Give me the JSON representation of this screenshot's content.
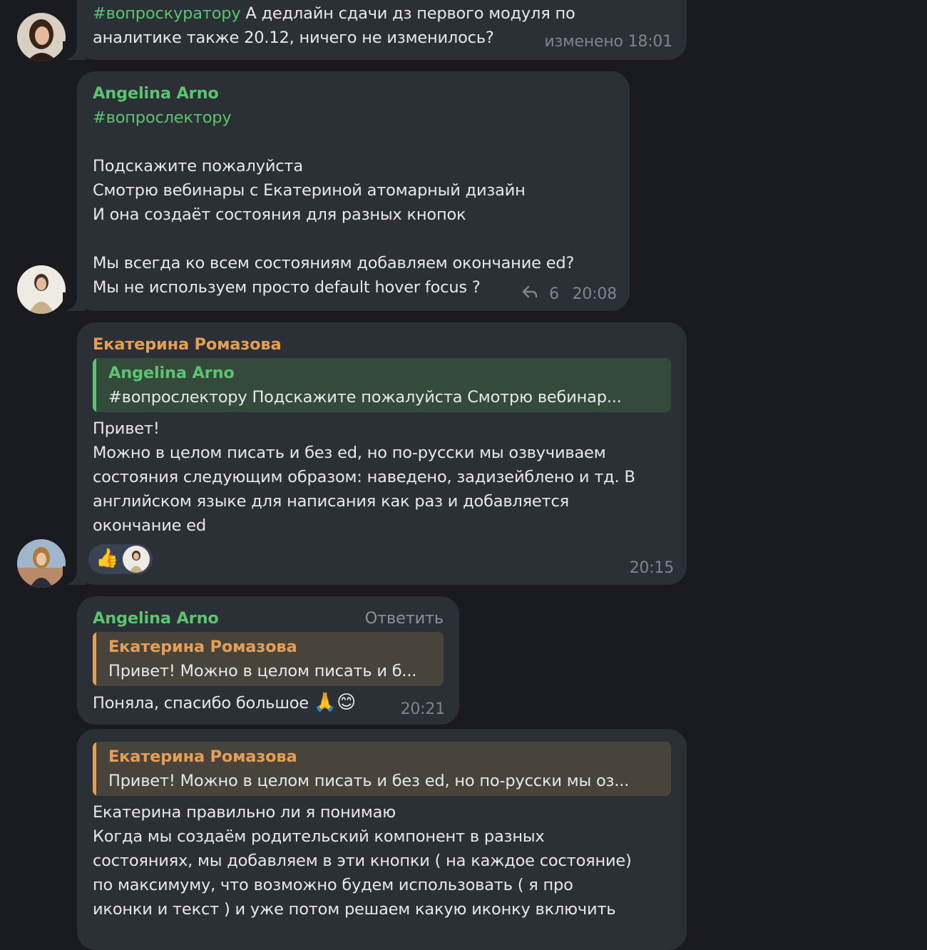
{
  "messages": [
    {
      "hashtag": "#вопроскуратору",
      "line1_rest": " А дедлайн сдачи дз первого модуля по",
      "line2": "аналитике также 20.12, ничего не изменилось?",
      "edited_label": "изменено",
      "time": "18:01"
    },
    {
      "sender": "Angelina Arno",
      "hashtag": "#вопрослектору",
      "lines_a": [
        "Подскажите пожалуйста",
        "Смотрю вебинары с Екатериной атомарный дизайн",
        "И она создаёт состояния для разных кнопок"
      ],
      "lines_b": [
        "Мы всегда ко всем состояниям добавляем окончание ed?",
        "Мы не используем просто default hover focus ?"
      ],
      "replies_count": "6",
      "time": "20:08"
    },
    {
      "sender": "Екатерина Ромазова",
      "quote_name": "Angelina Arno",
      "quote_text": "#вопрослектору   Подскажите пожалуйста  Смотрю вебинар...",
      "lines": [
        "Привет!",
        "Можно в целом писать и без ed, но по-русски мы озвучиваем",
        "состояния следующим образом: наведено, задизейблено и тд. В",
        "английском языке для написания как раз и добавляется",
        "окончание ed"
      ],
      "reaction_emoji": "👍",
      "time": "20:15"
    },
    {
      "sender": "Angelina Arno",
      "reply_label": "Ответить",
      "quote_name": "Екатерина Ромазова",
      "quote_text": "Привет! Можно в целом писать и б...",
      "text": "Поняла, спасибо большое",
      "emoji": "🙏😊",
      "time": "20:21"
    },
    {
      "quote_name": "Екатерина Ромазова",
      "quote_text": "Привет! Можно в целом писать и без ed, но по-русски мы оз...",
      "lines": [
        "Екатерина правильно ли я понимаю",
        "Когда мы создаём родительский компонент в разных",
        "состояниях, мы добавляем в эти кнопки ( на каждое состояние)",
        "по максимуму, что возможно будем использовать ( я про",
        "иконки и текст ) и уже потом решаем какую иконку включить"
      ]
    }
  ],
  "colors": {
    "background": "#1a1b20",
    "bubble": "#2b2f36",
    "green_name": "#5cc471",
    "orange_name": "#e59f54",
    "meta": "#7d858e"
  },
  "icons": {
    "reply_count_icon": "reply-arrow-icon"
  }
}
